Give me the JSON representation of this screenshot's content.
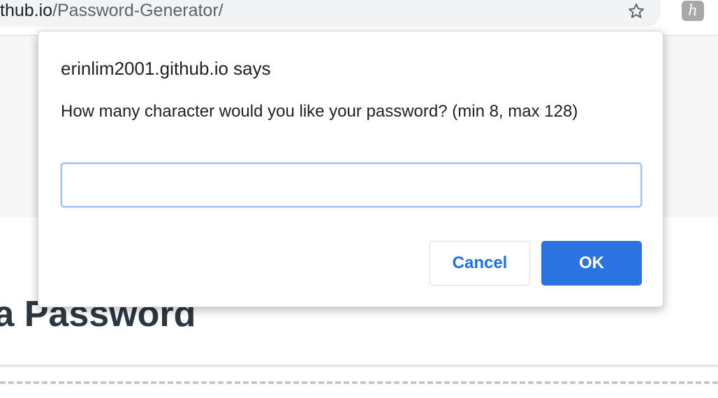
{
  "browser": {
    "url_host": "thub.io",
    "url_path": "/Password-Generator/",
    "bookmark_icon": "star-icon",
    "extension_icon": "extension-h-icon",
    "extension_glyph": "h"
  },
  "page": {
    "heading": "e a Password"
  },
  "dialog": {
    "title": "erinlim2001.github.io says",
    "message": "How many character would you like your password? (min 8, max 128)",
    "input_value": "",
    "cancel_label": "Cancel",
    "ok_label": "OK"
  },
  "colors": {
    "primary": "#2b73e0",
    "cancel_text": "#1a73e8",
    "input_focus_border": "#9cc2f7",
    "heading": "#2d3740"
  }
}
